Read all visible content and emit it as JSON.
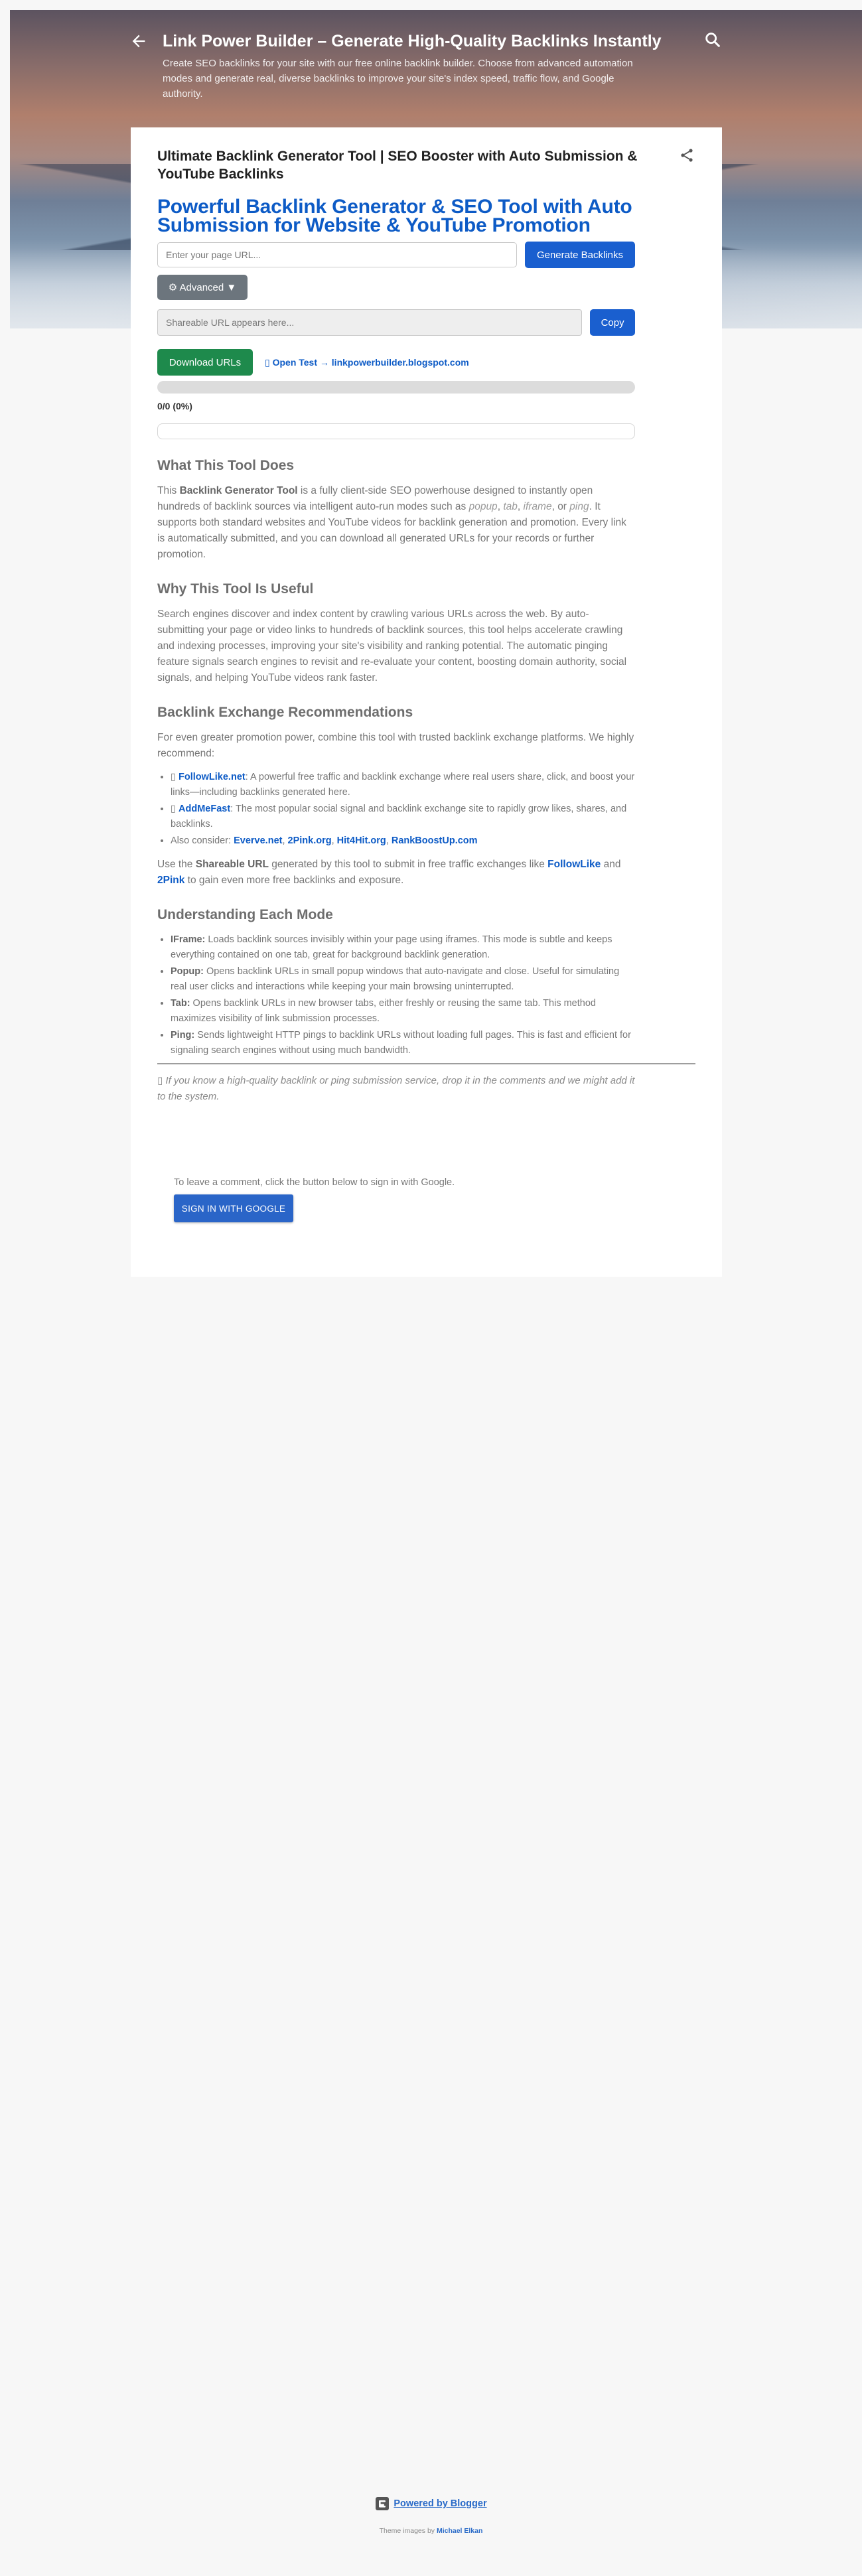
{
  "header": {
    "title": "Link Power Builder – Generate High-Quality Backlinks Instantly",
    "description": "Create SEO backlinks for your site with our free online backlink builder. Choose from advanced automation modes and generate real, diverse backlinks to improve your site's index speed, traffic flow, and Google authority.",
    "back_icon": "arrow-left-icon",
    "search_icon": "search-icon"
  },
  "post": {
    "title": "Ultimate Backlink Generator Tool | SEO Booster with Auto Submission & YouTube Backlinks",
    "share_icon": "share-icon"
  },
  "tool": {
    "heading": "Powerful Backlink Generator & SEO Tool with Auto Submission for Website & YouTube Promotion",
    "url_placeholder": "Enter your page URL...",
    "generate_label": "Generate Backlinks",
    "advanced_label": "⚙ Advanced ▼",
    "share_placeholder": "Shareable URL appears here...",
    "copy_label": "Copy",
    "download_label": "Download URLs",
    "open_test_label": "▯ Open Test → linkpowerbuilder.blogspot.com",
    "progress_fraction": 0,
    "progress_text": "0/0 (0%)"
  },
  "sections": {
    "what": {
      "heading": "What This Tool Does",
      "p1_a": "This ",
      "p1_b": "Backlink Generator Tool",
      "p1_c": " is a fully client-side SEO powerhouse designed to instantly open hundreds of backlink sources via intelligent auto-run modes such as ",
      "mode1": "popup",
      "sep1": ", ",
      "mode2": "tab",
      "sep2": ", ",
      "mode3": "iframe",
      "sep3": ", or ",
      "mode4": "ping",
      "p1_d": ". It supports both standard websites and YouTube videos for backlink generation and promotion. Every link is automatically submitted, and you can download all generated URLs for your records or further promotion."
    },
    "why": {
      "heading": "Why This Tool Is Useful",
      "text": "Search engines discover and index content by crawling various URLs across the web. By auto-submitting your page or video links to hundreds of backlink sources, this tool helps accelerate crawling and indexing processes, improving your site's visibility and ranking potential. The automatic pinging feature signals search engines to revisit and re-evaluate your content, boosting domain authority, social signals, and helping YouTube videos rank faster."
    },
    "exchange": {
      "heading": "Backlink Exchange Recommendations",
      "intro": "For even greater promotion power, combine this tool with trusted backlink exchange platforms. We highly recommend:",
      "items": [
        {
          "prefix": "▯ ",
          "link": "FollowLike.net",
          "text": ": A powerful free traffic and backlink exchange where real users share, click, and boost your links—including backlinks generated here."
        },
        {
          "prefix": "▯ ",
          "link": "AddMeFast",
          "text": ": The most popular social signal and backlink exchange site to rapidly grow likes, shares, and backlinks."
        }
      ],
      "also_label": "Also consider: ",
      "also_links": [
        "Everve.net",
        "2Pink.org",
        "Hit4Hit.org",
        "RankBoostUp.com"
      ],
      "outro_a": "Use the ",
      "outro_b": "Shareable URL",
      "outro_c": " generated by this tool to submit in free traffic exchanges like ",
      "outro_link1": "FollowLike",
      "outro_and": " and ",
      "outro_link2": "2Pink",
      "outro_d": " to gain even more free backlinks and exposure."
    },
    "modes": {
      "heading": "Understanding Each Mode",
      "items": [
        {
          "name": "IFrame:",
          "text": " Loads backlink sources invisibly within your page using iframes. This mode is subtle and keeps everything contained on one tab, great for background backlink generation."
        },
        {
          "name": "Popup:",
          "text": " Opens backlink URLs in small popup windows that auto-navigate and close. Useful for simulating real user clicks and interactions while keeping your main browsing uninterrupted."
        },
        {
          "name": "Tab:",
          "text": " Opens backlink URLs in new browser tabs, either freshly or reusing the same tab. This method maximizes visibility of link submission processes."
        },
        {
          "name": "Ping:",
          "text": " Sends lightweight HTTP pings to backlink URLs without loading full pages. This is fast and efficient for signaling search engines without using much bandwidth."
        }
      ]
    }
  },
  "footnote": "▯ If you know a high-quality backlink or ping submission service, drop it in the comments and we might add it to the system.",
  "comments": {
    "note": "To leave a comment, click the button below to sign in with Google.",
    "signin_label": "SIGN IN WITH GOOGLE"
  },
  "footer": {
    "powered": "Powered by Blogger",
    "credit_prefix": "Theme images by ",
    "credit_author": "Michael Elkan",
    "logo_icon": "blogger-logo-icon"
  },
  "colors": {
    "link_blue": "#0d5bc6",
    "generate_button": "#1a5fcf",
    "download_button": "#1e8a4c",
    "advanced_button": "#6c757d"
  }
}
